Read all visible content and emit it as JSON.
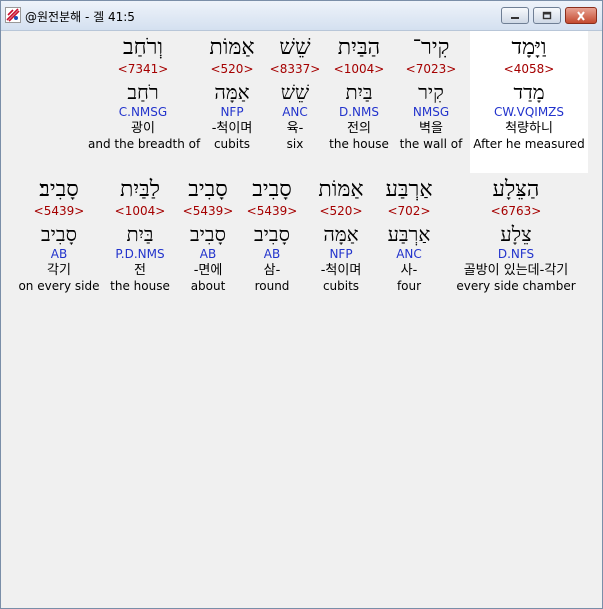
{
  "window": {
    "title": "@원전분해 - 겔 41:5",
    "colors": {
      "strong": "#a50000",
      "morph": "#2233cc"
    }
  },
  "row1": [
    {
      "heb": "וְרֹחַב",
      "strong": "<7341>",
      "lemma": "רֹחַב",
      "morph": "C.NMSG",
      "kor": "광이",
      "eng": "and the breadth of"
    },
    {
      "heb": "אַמּוֹת",
      "strong": "<520>",
      "lemma": "אַמָּה",
      "morph": "NFP",
      "kor": "-척이며",
      "eng": "cubits"
    },
    {
      "heb": "שֵׁשׁ",
      "strong": "<8337>",
      "lemma": "שֵׁשׁ",
      "morph": "ANC",
      "kor": "육-",
      "eng": "six"
    },
    {
      "heb": "הַבַּיִת",
      "strong": "<1004>",
      "lemma": "בַּיִת",
      "morph": "D.NMS",
      "kor": "전의",
      "eng": "the house"
    },
    {
      "heb": "קִיר־",
      "strong": "<7023>",
      "lemma": "קִיר",
      "morph": "NMSG",
      "kor": "벽을",
      "eng": "the wall of"
    },
    {
      "heb": "וַיָּמָד",
      "strong": "<4058>",
      "lemma": "מָדַד",
      "morph": "CW.VQIMZS",
      "kor": "척량하니",
      "eng": "After he measured"
    }
  ],
  "row2": [
    {
      "heb": "סָבִיב׃",
      "strong": "<5439>",
      "lemma": "סָבִיב",
      "morph": "AB",
      "kor": "각기",
      "eng": "on every side"
    },
    {
      "heb": "לַבַּיִת",
      "strong": "<1004>",
      "lemma": "בַּיִת",
      "morph": "P.D.NMS",
      "kor": "전",
      "eng": "the house"
    },
    {
      "heb": "סָבִיב",
      "strong": "<5439>",
      "lemma": "סָבִיב",
      "morph": "AB",
      "kor": "-면에",
      "eng": "about"
    },
    {
      "heb": "סָבִיב",
      "strong": "<5439>",
      "lemma": "סָבִיב",
      "morph": "AB",
      "kor": "삼-",
      "eng": "round"
    },
    {
      "heb": "אַמּוֹת",
      "strong": "<520>",
      "lemma": "אַמָּה",
      "morph": "NFP",
      "kor": "-척이며",
      "eng": "cubits"
    },
    {
      "heb": "אַרְבַּע",
      "strong": "<702>",
      "lemma": "אַרְבַּע",
      "morph": "ANC",
      "kor": "사-",
      "eng": "four"
    },
    {
      "heb": "הַצֵּלָע",
      "strong": "<6763>",
      "lemma": "צֵלָע",
      "morph": "D.NFS",
      "kor": "골방이 있는데-각기",
      "eng": "every side chamber"
    }
  ]
}
